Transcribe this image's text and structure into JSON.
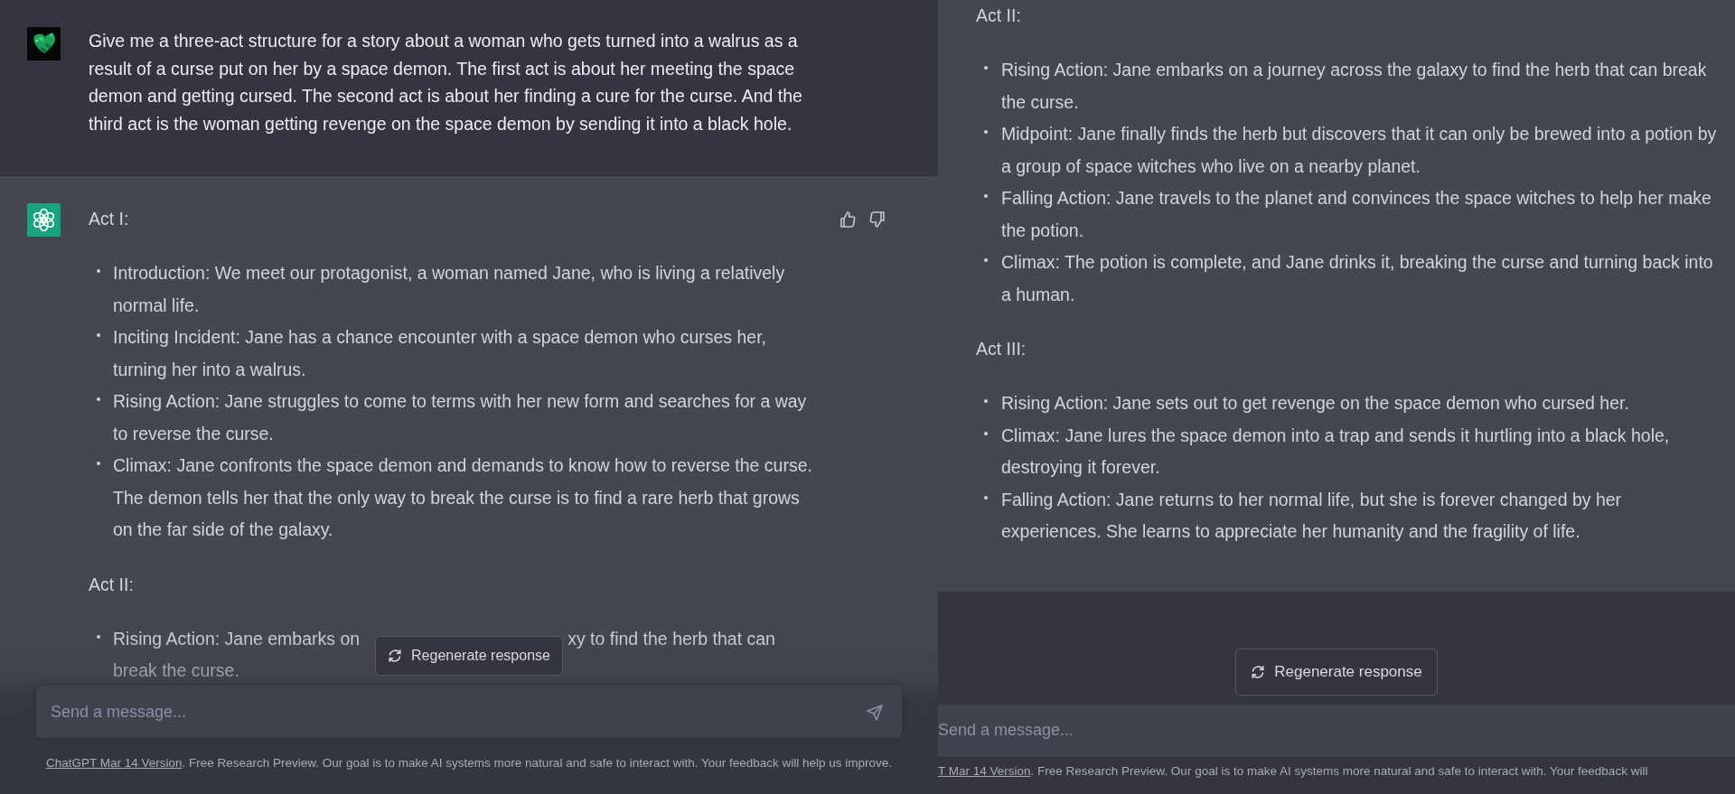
{
  "panels": [
    {
      "kind": "overlay",
      "messages": [
        {
          "kind": "prompt",
          "text": "Give me a three-act structure for a story about a woman who gets turned into a walrus as a result of a curse put on her by a space demon. The first act is about her meeting the space demon and getting cursed. The second act is about her finding a cure for the curse. And the third act is the woman getting revenge on the space demon by sending it into a black hole."
        },
        {
          "kind": "reply",
          "feedback": true,
          "sections": [
            {
              "heading": "Act I:",
              "items": [
                {
                  "kind": "plain",
                  "text": "Introduction: We meet our protagonist, a woman named Jane, who is living a relatively normal life."
                },
                {
                  "kind": "plain",
                  "text": "Inciting Incident: Jane has a chance encounter with a space demon who curses her, turning her into a walrus."
                },
                {
                  "kind": "plain",
                  "text": "Rising Action: Jane struggles to come to terms with her new form and searches for a way to reverse the curse."
                },
                {
                  "kind": "plain",
                  "text": "Climax: Jane confronts the space demon and demands to know how to reverse the curse. The demon tells her that the only way to break the curse is to find a rare herb that grows on the far side of the galaxy."
                }
              ]
            },
            {
              "heading": "Act II:",
              "items": [
                {
                  "kind": "occluded",
                  "before": "Rising Action: Jane embarks on",
                  "after": "xy to find the herb that can",
                  "continuation": "break the curse."
                }
              ]
            }
          ]
        }
      ],
      "regenerate_button": "Regenerate response",
      "input": {
        "placeholder": "Send a message...",
        "send_button": true
      },
      "footer": {
        "link": "ChatGPT Mar 14 Version",
        "text": ". Free Research Preview. Our goal is to make AI systems more natural and safe to interact with. Your feedback will help us improve."
      }
    },
    {
      "kind": "stacked",
      "messages": [
        {
          "kind": "reply_continued",
          "feedback": false,
          "sections": [
            {
              "heading": "Act II:",
              "items": [
                {
                  "kind": "plain",
                  "text": "Rising Action: Jane embarks on a journey across the galaxy to find the herb that can break the curse."
                },
                {
                  "kind": "plain",
                  "text": "Midpoint: Jane finally finds the herb but discovers that it can only be brewed into a potion by a group of space witches who live on a nearby planet."
                },
                {
                  "kind": "plain",
                  "text": "Falling Action: Jane travels to the planet and convinces the space witches to help her make the potion."
                },
                {
                  "kind": "plain",
                  "text": "Climax: The potion is complete, and Jane drinks it, breaking the curse and turning back into a human."
                }
              ]
            },
            {
              "heading": "Act III:",
              "items": [
                {
                  "kind": "plain",
                  "text": "Rising Action: Jane sets out to get revenge on the space demon who cursed her."
                },
                {
                  "kind": "plain",
                  "text": "Climax: Jane lures the space demon into a trap and sends it hurtling into a black hole, destroying it forever."
                },
                {
                  "kind": "plain",
                  "text": "Falling Action: Jane returns to her normal life, but she is forever changed by her experiences. She learns to appreciate her humanity and the fragility of life."
                }
              ]
            }
          ]
        }
      ],
      "regenerate_button": "Regenerate response",
      "input": {
        "placeholder": "Send a message...",
        "send_button": false
      },
      "footer": {
        "link": "T Mar 14 Version",
        "text": ". Free Research Preview. Our goal is to make AI systems more natural and safe to interact with. Your feedback will"
      }
    }
  ]
}
